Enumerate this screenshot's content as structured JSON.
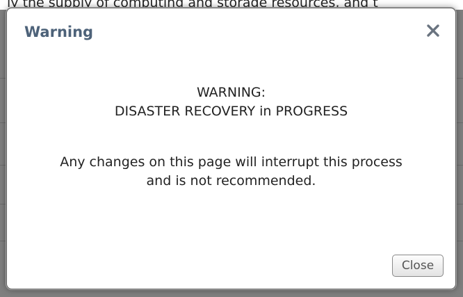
{
  "background": {
    "top_text": "ly the supply of computing and storage resources, and t"
  },
  "dialog": {
    "title": "Warning",
    "close_icon": "close-icon",
    "message": {
      "line1": "WARNING:",
      "line2": "DISASTER RECOVERY in PROGRESS",
      "line3": "Any changes on this page will interrupt this process",
      "line4": "and is not recommended."
    },
    "close_button_label": "Close"
  },
  "colors": {
    "title": "#4d6279",
    "overlay": "#7f7f7f",
    "dialog_bg": "#ffffff"
  }
}
